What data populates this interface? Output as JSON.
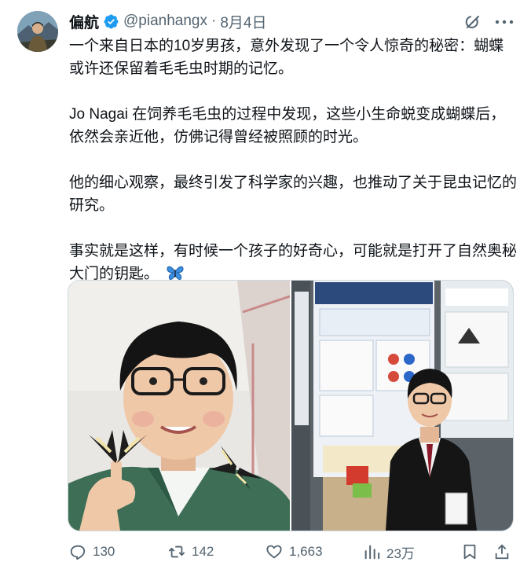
{
  "author": {
    "display_name": "偏航",
    "handle": "@pianhangx",
    "separator": "·",
    "date": "8月4日"
  },
  "tweet": {
    "paragraphs": [
      "一个来自日本的10岁男孩，意外发现了一个令人惊奇的秘密：蝴蝶或许还保留着毛毛虫时期的记忆。",
      "Jo Nagai 在饲养毛毛虫的过程中发现，这些小生命蜕变成蝴蝶后，依然会亲近他，仿佛记得曾经被照顾的时光。",
      "他的细心观察，最终引发了科学家的兴趣，也推动了关于昆虫记忆的研究。",
      "事实就是这样，有时候一个孩子的好奇心，可能就是打开了自然奥秘大门的钥匙。"
    ],
    "emoji": "butterfly"
  },
  "icons": {
    "verified": "verified-badge-icon",
    "grok": "grok-icon",
    "more": "more-icon"
  },
  "stats": {
    "replies": "130",
    "reposts": "142",
    "likes": "1,663",
    "views": "23万"
  },
  "colors": {
    "text": "#0f1419",
    "secondary": "#536471",
    "verified_blue": "#1d9bf0",
    "border": "#cfd9de"
  }
}
